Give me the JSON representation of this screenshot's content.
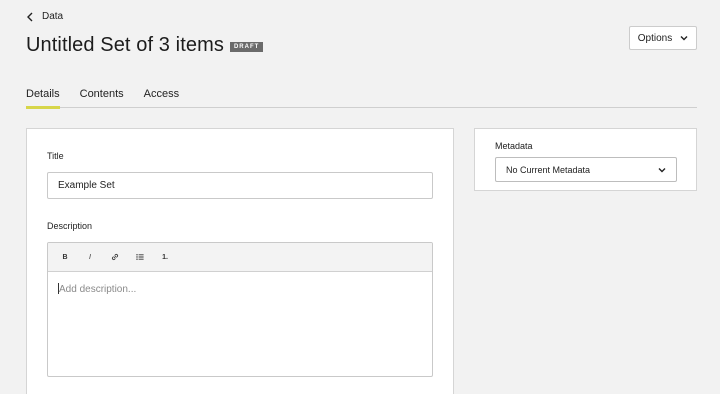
{
  "nav": {
    "back_label": "Data"
  },
  "header": {
    "title": "Untitled Set of 3 items",
    "badge": "DRAFT",
    "options_label": "Options"
  },
  "tabs": [
    {
      "label": "Details",
      "active": true
    },
    {
      "label": "Contents",
      "active": false
    },
    {
      "label": "Access",
      "active": false
    }
  ],
  "form": {
    "title_label": "Title",
    "title_value": "Example Set",
    "description_label": "Description",
    "description_placeholder": "Add description...",
    "toolbar": {
      "bold": "B",
      "italic": "I",
      "ordered_list": "1."
    }
  },
  "metadata": {
    "label": "Metadata",
    "selected": "No Current Metadata"
  },
  "colors": {
    "accent": "#d7d64a",
    "badge_bg": "#6b6b6b",
    "background": "#f2f2f2"
  },
  "icons": [
    "chevron-left-icon",
    "chevron-down-icon",
    "link-icon",
    "bullet-list-icon"
  ]
}
